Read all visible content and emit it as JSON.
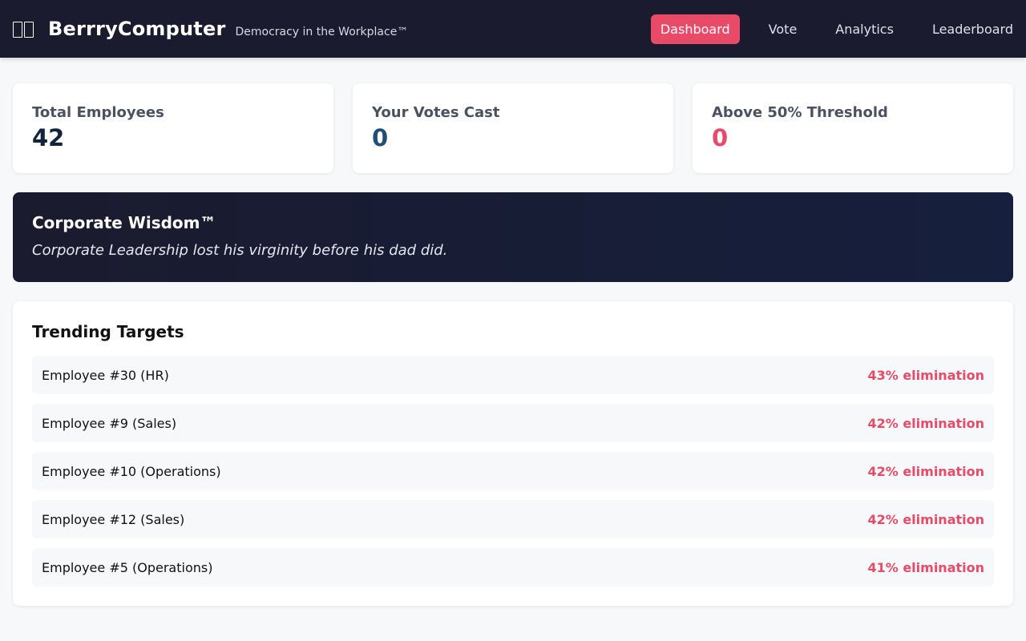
{
  "header": {
    "app_name": "BerrryComputer",
    "tagline": "Democracy in the Workplace™",
    "logo_icon": "two-rectangles-icon",
    "nav": [
      {
        "label": "Dashboard",
        "active": true
      },
      {
        "label": "Vote",
        "active": false
      },
      {
        "label": "Analytics",
        "active": false
      },
      {
        "label": "Leaderboard",
        "active": false
      }
    ]
  },
  "stats": [
    {
      "label": "Total Employees",
      "value": "42"
    },
    {
      "label": "Your Votes Cast",
      "value": "0"
    },
    {
      "label": "Above 50% Threshold",
      "value": "0"
    }
  ],
  "wisdom": {
    "title": "Corporate Wisdom™",
    "quote": "Corporate Leadership lost his virginity before his dad did."
  },
  "trending": {
    "title": "Trending Targets",
    "rows": [
      {
        "name": "Employee #30 (HR)",
        "pct": "43% elimination"
      },
      {
        "name": "Employee #9 (Sales)",
        "pct": "42% elimination"
      },
      {
        "name": "Employee #10 (Operations)",
        "pct": "42% elimination"
      },
      {
        "name": "Employee #12 (Sales)",
        "pct": "42% elimination"
      },
      {
        "name": "Employee #5 (Operations)",
        "pct": "41% elimination"
      }
    ]
  },
  "colors": {
    "header_bg": "#1a1b2e",
    "accent": "#e84a68",
    "page_bg": "#f7f8fa"
  }
}
